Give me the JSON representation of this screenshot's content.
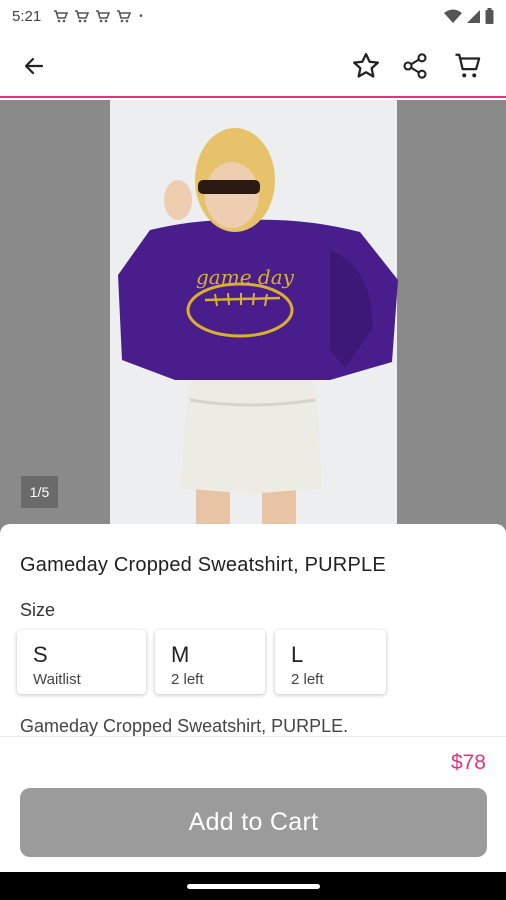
{
  "status_bar": {
    "time": "5:21",
    "notification_icons": [
      "cart-icon",
      "cart-icon",
      "cart-icon",
      "cart-icon"
    ],
    "dot": "•"
  },
  "app_bar": {
    "icons": [
      "back-arrow-icon",
      "star-icon",
      "share-icon",
      "shopping-cart-icon"
    ]
  },
  "image": {
    "counter": "1/5",
    "sweatshirt_text": "game day"
  },
  "product": {
    "title": "Gameday Cropped Sweatshirt, PURPLE",
    "size_label": "Size",
    "sizes": [
      {
        "letter": "S",
        "status": "Waitlist"
      },
      {
        "letter": "M",
        "status": "2 left"
      },
      {
        "letter": "L",
        "status": "2 left"
      }
    ],
    "description": "Gameday Cropped Sweatshirt, PURPLE."
  },
  "bottom_bar": {
    "price": "$78",
    "add_to_cart_label": "Add to Cart"
  },
  "colors": {
    "accent": "#e5317f",
    "button_disabled": "#9b9b9b",
    "sweatshirt": "#4a1d8c",
    "script_gold": "#d8b030"
  }
}
